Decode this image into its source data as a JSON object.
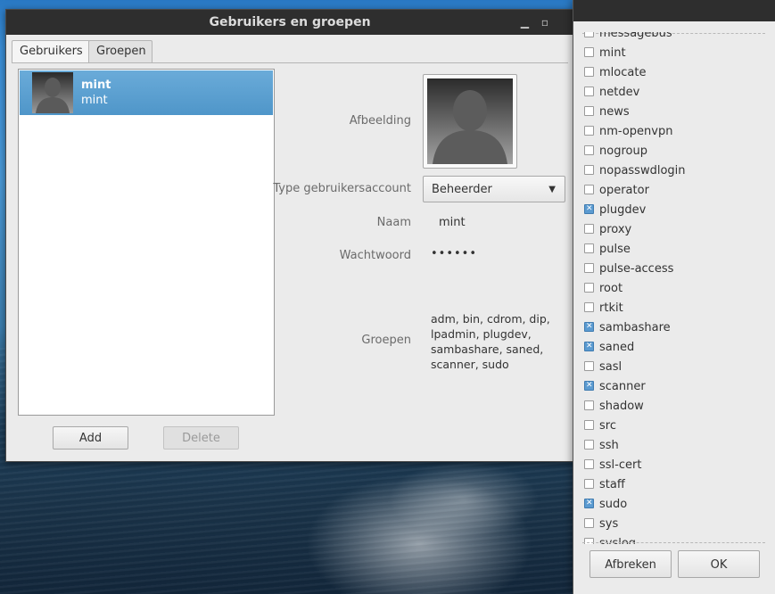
{
  "window": {
    "title": "Gebruikers en groepen",
    "minimize_glyph": "▁",
    "maximize_glyph": "▫"
  },
  "tabs": [
    {
      "label": "Gebruikers",
      "active": true
    },
    {
      "label": "Groepen",
      "active": false
    }
  ],
  "user_list": [
    {
      "name": "mint",
      "login": "mint",
      "selected": true
    }
  ],
  "buttons": {
    "add": "Add",
    "delete": "Delete"
  },
  "details": {
    "image_label": "Afbeelding",
    "type_label": "Type gebruikersaccount",
    "type_value": "Beheerder",
    "name_label": "Naam",
    "name_value": "mint",
    "password_label": "Wachtwoord",
    "password_value": "••••••",
    "groups_label": "Groepen",
    "groups_value": "adm, bin, cdrom, dip, lpadmin, plugdev, sambashare, saned, scanner, sudo"
  },
  "group_dialog": {
    "items": [
      {
        "name": "messagebus",
        "checked": false
      },
      {
        "name": "mint",
        "checked": false
      },
      {
        "name": "mlocate",
        "checked": false
      },
      {
        "name": "netdev",
        "checked": false
      },
      {
        "name": "news",
        "checked": false
      },
      {
        "name": "nm-openvpn",
        "checked": false
      },
      {
        "name": "nogroup",
        "checked": false
      },
      {
        "name": "nopasswdlogin",
        "checked": false
      },
      {
        "name": "operator",
        "checked": false
      },
      {
        "name": "plugdev",
        "checked": true
      },
      {
        "name": "proxy",
        "checked": false
      },
      {
        "name": "pulse",
        "checked": false
      },
      {
        "name": "pulse-access",
        "checked": false
      },
      {
        "name": "root",
        "checked": false
      },
      {
        "name": "rtkit",
        "checked": false
      },
      {
        "name": "sambashare",
        "checked": true
      },
      {
        "name": "saned",
        "checked": true
      },
      {
        "name": "sasl",
        "checked": false
      },
      {
        "name": "scanner",
        "checked": true
      },
      {
        "name": "shadow",
        "checked": false
      },
      {
        "name": "src",
        "checked": false
      },
      {
        "name": "ssh",
        "checked": false
      },
      {
        "name": "ssl-cert",
        "checked": false
      },
      {
        "name": "staff",
        "checked": false
      },
      {
        "name": "sudo",
        "checked": true
      },
      {
        "name": "sys",
        "checked": false
      },
      {
        "name": "syslog",
        "checked": false
      }
    ],
    "cancel": "Afbreken",
    "ok": "OK"
  },
  "colors": {
    "selection": "#5aa0d0",
    "titlebar": "#2e2e2e",
    "checkbox_checked": "#5b9bd1"
  }
}
